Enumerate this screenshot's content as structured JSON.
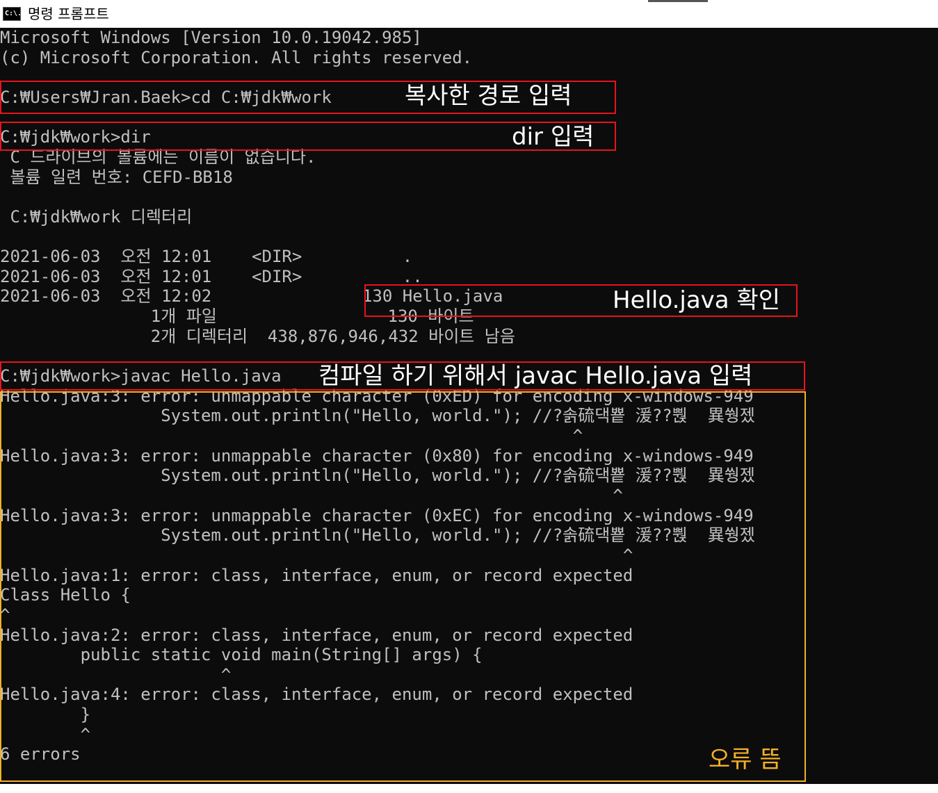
{
  "window": {
    "title": "명령 프롬프트",
    "icon": "cmd-icon",
    "icon_text": "C:\\."
  },
  "console": {
    "lines": [
      "Microsoft Windows [Version 10.0.19042.985]",
      "(c) Microsoft Corporation. All rights reserved.",
      "",
      "C:₩Users₩Jran.Baek>cd C:₩jdk₩work",
      "",
      "C:₩jdk₩work>dir",
      " C 드라이브의 볼륨에는 이름이 없습니다.",
      " 볼륨 일련 번호: CEFD-BB18",
      "",
      " C:₩jdk₩work 디렉터리",
      "",
      "2021-06-03  오전 12:01    <DIR>          .",
      "2021-06-03  오전 12:01    <DIR>          ..",
      "2021-06-03  오전 12:02               130 Hello.java",
      "               1개 파일                 130 바이트",
      "               2개 디렉터리  438,876,946,432 바이트 남음",
      "",
      "C:₩jdk₩work>javac Hello.java",
      "Hello.java:3: error: unmappable character (0xED) for encoding x-windows-949",
      "                System.out.println(\"Hello, world.\"); //?솕硫댁뿉 湲??뿭  異쒕젰",
      "                                                         ^",
      "Hello.java:3: error: unmappable character (0x80) for encoding x-windows-949",
      "                System.out.println(\"Hello, world.\"); //?솕硫댁뿉 湲??뿭  異쒕젰",
      "                                                             ^",
      "Hello.java:3: error: unmappable character (0xEC) for encoding x-windows-949",
      "                System.out.println(\"Hello, world.\"); //?솕硫댁뿉 湲??뿭  異쒕젰",
      "                                                              ^",
      "Hello.java:1: error: class, interface, enum, or record expected",
      "Class Hello {",
      "^",
      "Hello.java:2: error: class, interface, enum, or record expected",
      "        public static void main(String[] args) {",
      "                      ^",
      "Hello.java:4: error: class, interface, enum, or record expected",
      "        }",
      "        ^",
      "6 errors"
    ]
  },
  "annotations": {
    "cd_label": "복사한 경로 입력",
    "dir_label": "dir 입력",
    "hello_label": "Hello.java 확인",
    "javac_label": "컴파일 하기 위해서 javac Hello.java 입력",
    "errors_label": "오류 뜸"
  },
  "colors": {
    "console_bg": "#0c0c0c",
    "console_text": "#c0c0c0",
    "highlight_red": "#e8141c",
    "highlight_orange": "#f5b026"
  }
}
